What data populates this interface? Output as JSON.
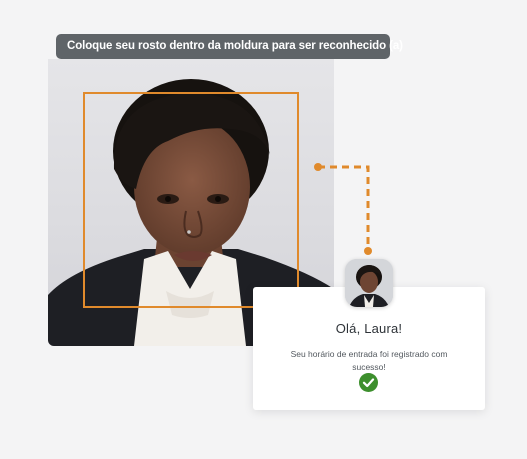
{
  "instruction": {
    "text": "Coloque seu rosto dentro da moldura para ser reconhecido (a)"
  },
  "camera": {
    "face_frame_color": "#e08a2c"
  },
  "connector": {
    "color": "#e08a2c",
    "style": "dashed"
  },
  "confirmation_card": {
    "greeting": "Olá, Laura!",
    "message": "Seu horário de entrada foi registrado com sucesso!",
    "status_icon": "check-circle-icon",
    "status_color": "#3d8f2d"
  }
}
